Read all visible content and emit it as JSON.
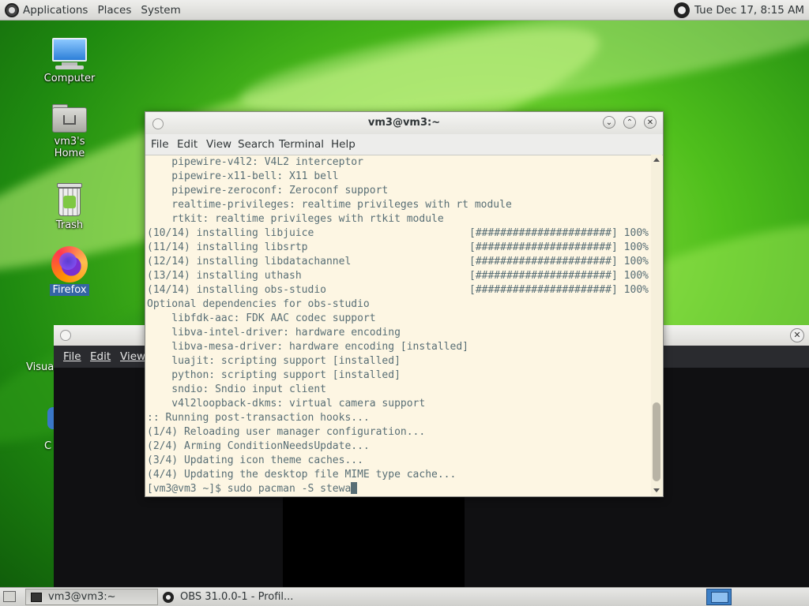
{
  "top_panel": {
    "menus": [
      "Applications",
      "Places",
      "System"
    ],
    "clock": "Tue Dec 17,  8:15 AM"
  },
  "desktop_icons": [
    {
      "label": "Computer",
      "icon": "computer-icon"
    },
    {
      "label": "vm3's Home",
      "icon": "home-folder-icon"
    },
    {
      "label": "Trash",
      "icon": "trash-icon"
    },
    {
      "label": "Firefox",
      "icon": "firefox-icon"
    }
  ],
  "obs_window": {
    "menus": [
      "File",
      "Edit",
      "View"
    ],
    "partial_desktop_label": "Visual",
    "partial_desktop_label2": "C"
  },
  "terminal": {
    "title": "vm3@vm3:~",
    "menus": [
      "File",
      "Edit",
      "View",
      "Search",
      "Terminal",
      "Help"
    ],
    "lines": [
      "    pipewire-v4l2: V4L2 interceptor",
      "    pipewire-x11-bell: X11 bell",
      "    pipewire-zeroconf: Zeroconf support",
      "    realtime-privileges: realtime privileges with rt module",
      "    rtkit: realtime privileges with rtkit module",
      "(10/14) installing libjuice",
      "(11/14) installing libsrtp",
      "(12/14) installing libdatachannel",
      "(13/14) installing uthash",
      "(14/14) installing obs-studio",
      "Optional dependencies for obs-studio",
      "    libfdk-aac: FDK AAC codec support",
      "    libva-intel-driver: hardware encoding",
      "    libva-mesa-driver: hardware encoding [installed]",
      "    luajit: scripting support [installed]",
      "    python: scripting support [installed]",
      "    sndio: Sndio input client",
      "    v4l2loopback-dkms: virtual camera support",
      ":: Running post-transaction hooks...",
      "(1/4) Reloading user manager configuration...",
      "(2/4) Arming ConditionNeedsUpdate...",
      "(3/4) Updating icon theme caches...",
      "(4/4) Updating the desktop file MIME type cache...",
      "[vm3@vm3 ~]$ sudo pacman -S stewa"
    ],
    "progress_bars": [
      "[######################] 100%",
      "[######################] 100%",
      "[######################] 100%",
      "[######################] 100%",
      "[######################] 100%"
    ]
  },
  "taskbar": {
    "tasks": [
      {
        "label": "vm3@vm3:~",
        "active": true
      },
      {
        "label": "OBS 31.0.0-1 - Profil...",
        "active": false
      }
    ]
  },
  "colors": {
    "terminal_bg": "#fdf6e3",
    "terminal_fg": "#586e75",
    "selection": "#3465a4"
  }
}
